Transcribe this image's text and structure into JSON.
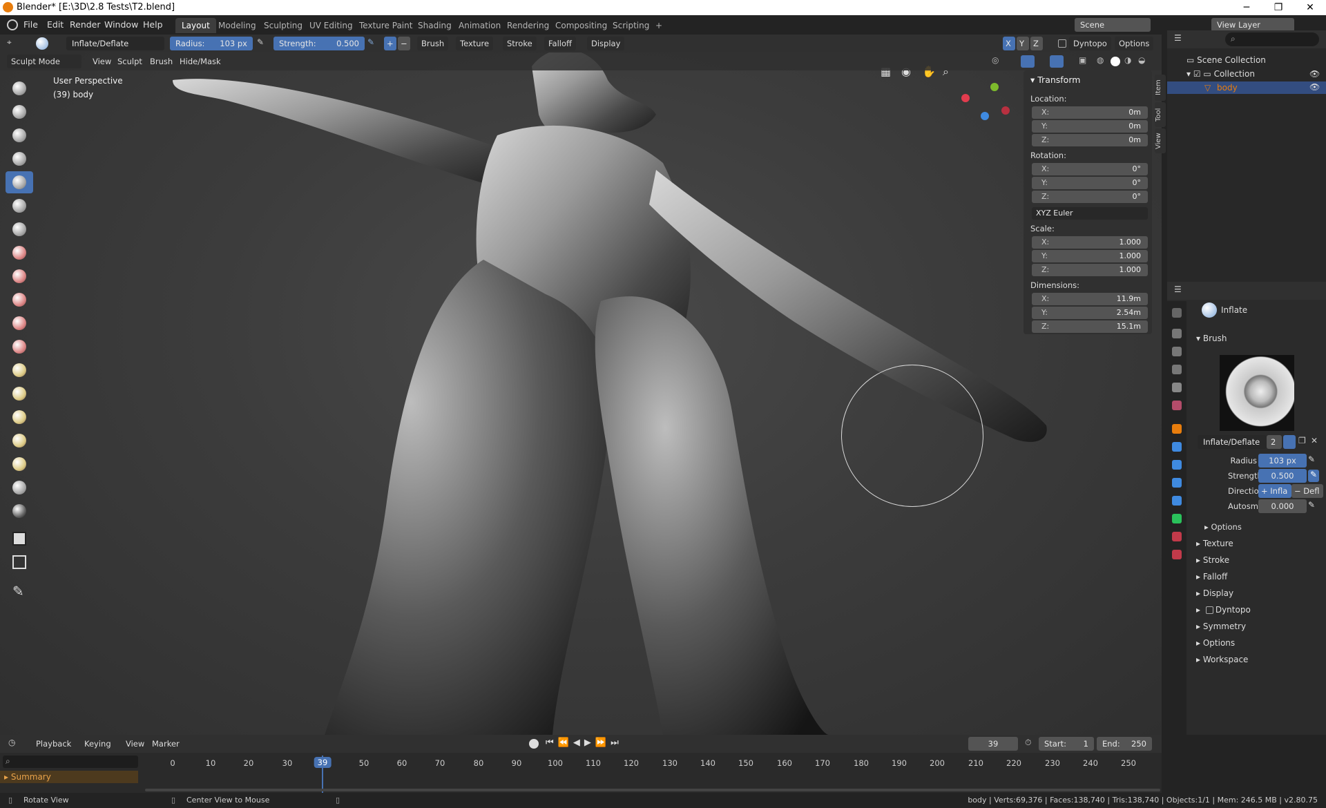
{
  "window": {
    "title": "Blender* [E:\\3D\\2.8 Tests\\T2.blend]",
    "min": "─",
    "max": "❐",
    "close": "✕"
  },
  "menu": [
    "File",
    "Edit",
    "Render",
    "Window",
    "Help"
  ],
  "workspaces": [
    "Layout",
    "Modeling",
    "Sculpting",
    "UV Editing",
    "Texture Paint",
    "Shading",
    "Animation",
    "Rendering",
    "Compositing",
    "Scripting"
  ],
  "workspace_add": "+",
  "scene": {
    "label": "Scene",
    "view_layer": "View Layer"
  },
  "toolheader": {
    "brush_name": "Inflate/Deflate",
    "radius_label": "Radius:",
    "radius_value": "103 px",
    "strength_label": "Strength:",
    "strength_value": "0.500",
    "plus": "+",
    "minus": "−",
    "dropdowns": [
      "Brush",
      "Texture",
      "Stroke",
      "Falloff",
      "Display"
    ],
    "axes": [
      "X",
      "Y",
      "Z"
    ],
    "dyntopo": "Dyntopo",
    "options": "Options"
  },
  "modeheader": {
    "mode": "Sculpt Mode",
    "items": [
      "View",
      "Sculpt",
      "Brush",
      "Hide/Mask"
    ]
  },
  "viewport": {
    "perspective": "User Perspective",
    "object": "(39) body"
  },
  "npanel": {
    "title": "Transform",
    "location_label": "Location:",
    "location": [
      {
        "k": "X:",
        "v": "0m"
      },
      {
        "k": "Y:",
        "v": "0m"
      },
      {
        "k": "Z:",
        "v": "0m"
      }
    ],
    "rotation_label": "Rotation:",
    "rotation": [
      {
        "k": "X:",
        "v": "0°"
      },
      {
        "k": "Y:",
        "v": "0°"
      },
      {
        "k": "Z:",
        "v": "0°"
      }
    ],
    "rotation_mode": "XYZ Euler",
    "scale_label": "Scale:",
    "scale": [
      {
        "k": "X:",
        "v": "1.000"
      },
      {
        "k": "Y:",
        "v": "1.000"
      },
      {
        "k": "Z:",
        "v": "1.000"
      }
    ],
    "dimensions_label": "Dimensions:",
    "dimensions": [
      {
        "k": "X:",
        "v": "11.9m"
      },
      {
        "k": "Y:",
        "v": "2.54m"
      },
      {
        "k": "Z:",
        "v": "15.1m"
      }
    ]
  },
  "sidetabs": [
    "Item",
    "Tool",
    "View"
  ],
  "outliner": {
    "scene_collection": "Scene Collection",
    "collection": "Collection",
    "object": "body"
  },
  "properties": {
    "brush_title": "Inflate",
    "brush_section": "Brush",
    "brush_name": "Inflate/Deflate",
    "users": "2",
    "radius_label": "Radius",
    "radius": "103 px",
    "strength_label": "Strength",
    "strength": "0.500",
    "direction_label": "Direction",
    "dir_a": "+ Infla",
    "dir_b": "− Defl",
    "autosmooth_label": "Autosmooth",
    "autosmooth": "0.000",
    "options_sub": "Options",
    "sections": [
      "Texture",
      "Stroke",
      "Falloff",
      "Display",
      "Dyntopo",
      "Symmetry",
      "Options",
      "Workspace"
    ]
  },
  "timeline": {
    "menus": [
      "Playback",
      "Keying",
      "View",
      "Marker"
    ],
    "current_frame": "39",
    "start_label": "Start:",
    "start": "1",
    "end_label": "End:",
    "end": "250",
    "ticks": [
      "0",
      "10",
      "20",
      "30",
      "39",
      "50",
      "60",
      "70",
      "80",
      "90",
      "100",
      "110",
      "120",
      "130",
      "140",
      "150",
      "160",
      "170",
      "180",
      "190",
      "200",
      "210",
      "220",
      "230",
      "240",
      "250"
    ],
    "summary": "Summary"
  },
  "statusbar": {
    "left1": "Rotate View",
    "left2": "Center View to Mouse",
    "stats": "body | Verts:69,376 | Faces:138,740 | Tris:138,740 | Objects:1/1 | Mem: 246.5 MB | v2.80.75"
  },
  "colors": {
    "accent": "#4772b3",
    "brand": "#e87d0d",
    "header": "#303030",
    "field": "#545454"
  }
}
